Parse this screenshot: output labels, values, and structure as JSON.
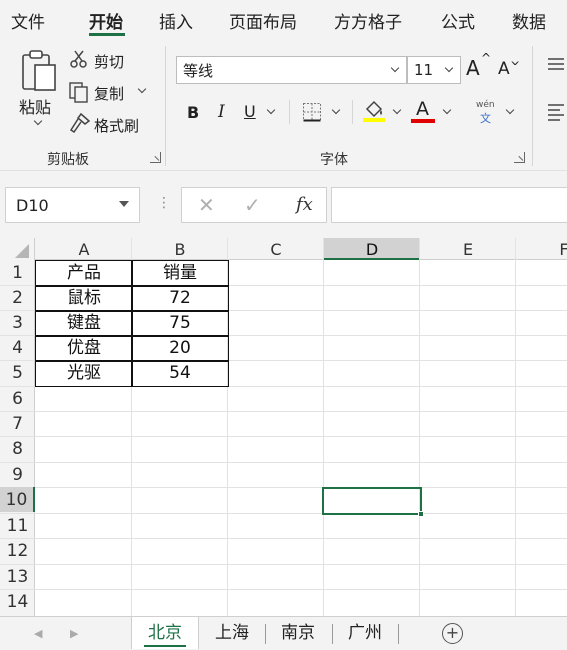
{
  "tabs": [
    "文件",
    "开始",
    "插入",
    "页面布局",
    "方方格子",
    "公式",
    "数据"
  ],
  "active_tab": "开始",
  "accent_color": "#1e7145",
  "ribbon": {
    "clipboard": {
      "paste_label": "粘贴",
      "cut_label": "剪切",
      "copy_label": "复制",
      "format_painter_label": "格式刷",
      "group_label": "剪贴板"
    },
    "font": {
      "font_name": "等线",
      "font_size": "11",
      "grow_label": "A",
      "shrink_label": "A",
      "bold_label": "B",
      "italic_label": "I",
      "underline_label": "U",
      "font_color_label": "A",
      "fill_color": "#ffff00",
      "font_color": "#e00000",
      "phonetic_top": "wén",
      "phonetic_bottom": "文",
      "group_label": "字体"
    }
  },
  "formula_bar": {
    "name_box": "D10",
    "dots": "⋮",
    "cancel": "✕",
    "enter": "✓",
    "fx": "fx",
    "formula": ""
  },
  "sheet": {
    "columns": [
      "A",
      "B",
      "C",
      "D",
      "E",
      "F"
    ],
    "rows": [
      "1",
      "2",
      "3",
      "4",
      "5",
      "6",
      "7",
      "8",
      "9",
      "10",
      "11",
      "12",
      "13",
      "14"
    ],
    "selected_column": "D",
    "selected_row": "10",
    "cells": [
      [
        "产品",
        "销量"
      ],
      [
        "鼠标",
        "72"
      ],
      [
        "键盘",
        "75"
      ],
      [
        "优盘",
        "20"
      ],
      [
        "光驱",
        "54"
      ]
    ]
  },
  "sheet_tabs": [
    "北京",
    "上海",
    "南京",
    "广州"
  ],
  "active_sheet": "北京",
  "add_sheet": "+"
}
